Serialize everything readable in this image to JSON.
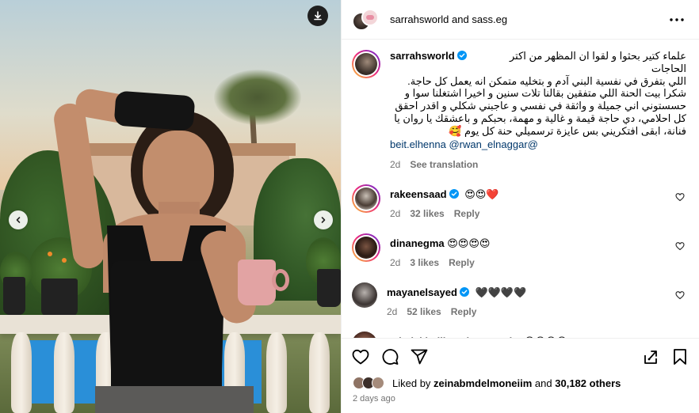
{
  "header": {
    "title": "sarrahsworld and sass.eg"
  },
  "caption": {
    "username": "sarrahsworld",
    "lines": [
      "علماء كتير بحثوا و لقوا ان المظهر من اكتر الحاجات",
      "اللي بتفرق في نفسية البني آدم و بتخليه متمكن انه يعمل كل حاجة.",
      "شكرا بيت الحنة اللي متفقين بقالنا تلات سنين و اخيرا اشتغلنا سوا و",
      "حسستوني اني جميلة و واثقة في نفسي و عاجبني شكلي و اقدر احقق",
      "كل احلامي، دي حاجة قيمة و غالية و مهمة، بحبكم و باعشقك يا روان يا",
      "فنانة، ابقى افتكريني بس عايزة ترسميلي حنة كل يوم 🥰"
    ],
    "tags": "beit.elhenna @rwan_elnaggar@",
    "time": "2d",
    "see_translation": "See translation"
  },
  "comments": [
    {
      "username": "rakeensaad",
      "verified": true,
      "text": "😍😍❤️",
      "time": "2d",
      "likes": "32 likes",
      "reply": "Reply"
    },
    {
      "username": "dinanegma",
      "verified": false,
      "text": "😍😍😍😍",
      "time": "2d",
      "likes": "3 likes",
      "reply": "Reply"
    },
    {
      "username": "mayanelsayed",
      "verified": true,
      "text": "🖤🖤🖤🖤",
      "time": "2d",
      "likes": "52 likes",
      "reply": "Reply"
    },
    {
      "username": "nehal_khalil_makeup_artist",
      "verified": false,
      "text": "😍😍😍😍",
      "time": "",
      "likes": "",
      "reply": ""
    }
  ],
  "likes": {
    "prefix": "Liked by",
    "user": "zeinabmdelmoneiim",
    "middle": "and",
    "count": "30,182 others"
  },
  "posted_ago": "2 days ago",
  "icons": {
    "download": "download-icon",
    "prev": "chevron-left-icon",
    "next": "chevron-right-icon",
    "more": "more-options-icon",
    "like": "heart-icon",
    "comment": "comment-icon",
    "share": "share-icon",
    "save": "bookmark-icon",
    "remix": "remix-icon",
    "verified": "verified-badge-icon"
  },
  "colors": {
    "link": "#00376b",
    "muted": "#737373",
    "verified": "#0095f6",
    "story_ring_start": "#f9ce34",
    "story_ring_end": "#6228d7"
  }
}
